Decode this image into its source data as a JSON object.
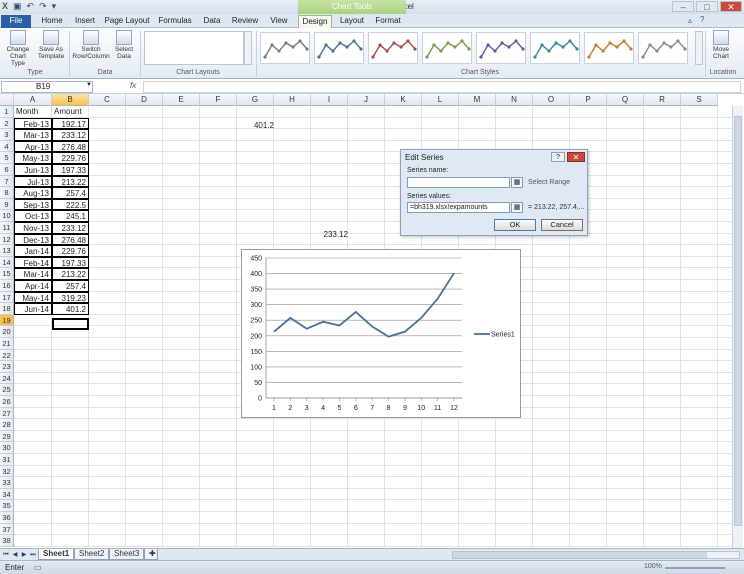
{
  "window": {
    "title": "bh319  -  Microsoft Excel",
    "context_title": "Chart Tools",
    "minimize": "–",
    "restore": "□",
    "close": "✕"
  },
  "qat_icons": [
    "excel-logo-icon",
    "save-icon",
    "undo-icon",
    "redo-icon",
    "customize-icon"
  ],
  "ribbon": {
    "tabs": [
      "File",
      "Home",
      "Insert",
      "Page Layout",
      "Formulas",
      "Data",
      "Review",
      "View",
      "Design",
      "Layout",
      "Format"
    ],
    "active_tab": "Design",
    "buttons": {
      "change_chart_type": "Change Chart Type",
      "save_as_template": "Save As Template",
      "switch_row_column": "Switch Row/Column",
      "select_data": "Select Data",
      "move_chart": "Move Chart"
    },
    "groups": {
      "type": "Type",
      "data": "Data",
      "chart_layouts": "Chart Layouts",
      "chart_styles": "Chart Styles",
      "location": "Location"
    }
  },
  "formula_bar": {
    "name_box": "B19",
    "fx": "fx",
    "value": ""
  },
  "columns": [
    "A",
    "B",
    "C",
    "D",
    "E",
    "F",
    "G",
    "H",
    "I",
    "J",
    "K",
    "L",
    "M",
    "N",
    "O",
    "P",
    "Q",
    "R",
    "S"
  ],
  "selected_column": "B",
  "rows": [
    "1",
    "2",
    "3",
    "4",
    "5",
    "6",
    "7",
    "8",
    "9",
    "10",
    "11",
    "12",
    "13",
    "14",
    "15",
    "16",
    "17",
    "18",
    "19",
    "20",
    "21",
    "22",
    "23",
    "24",
    "25",
    "26",
    "27",
    "28",
    "29",
    "30",
    "31",
    "32",
    "33",
    "34",
    "35",
    "36",
    "37",
    "38"
  ],
  "selected_row": "19",
  "table": {
    "headers": [
      "Month",
      "Amount"
    ],
    "rows": [
      [
        "Feb-13",
        "192.17"
      ],
      [
        "Mar-13",
        "233.12"
      ],
      [
        "Apr-13",
        "276.48"
      ],
      [
        "May-13",
        "229.76"
      ],
      [
        "Jun-13",
        "197.33"
      ],
      [
        "Jul-13",
        "213.22"
      ],
      [
        "Aug-13",
        "257.4"
      ],
      [
        "Sep-13",
        "222.5"
      ],
      [
        "Oct-13",
        "245.1"
      ],
      [
        "Nov-13",
        "233.12"
      ],
      [
        "Dec-13",
        "276.48"
      ],
      [
        "Jan-14",
        "229.76"
      ],
      [
        "Feb-14",
        "197.33"
      ],
      [
        "Mar-14",
        "213.22"
      ],
      [
        "Apr-14",
        "257.4"
      ],
      [
        "May-14",
        "319.23"
      ],
      [
        "Jun-14",
        "401.2"
      ]
    ]
  },
  "loose_cells": {
    "g2": "401.2",
    "i11": "233.12"
  },
  "chart_data": {
    "type": "line",
    "x": [
      1,
      2,
      3,
      4,
      5,
      6,
      7,
      8,
      9,
      10,
      11,
      12
    ],
    "series": [
      {
        "name": "Series1",
        "values": [
          213.22,
          257.4,
          222.5,
          245.1,
          233.12,
          276.48,
          229.76,
          197.33,
          213.22,
          257.4,
          319.23,
          401.2
        ]
      }
    ],
    "yticks": [
      0,
      50,
      100,
      150,
      200,
      250,
      300,
      350,
      400,
      450
    ],
    "ylim": [
      0,
      450
    ],
    "grid": true,
    "legend": "right",
    "color": "#4a6f9b"
  },
  "dialog": {
    "title": "Edit Series",
    "help": "?",
    "close": "✕",
    "series_name_label": "Series name:",
    "series_name_value": "",
    "select_range_hint": "Select Range",
    "series_values_label": "Series values:",
    "series_values_value": "=bh319.xlsx!expamounts",
    "series_values_preview": "= 213.22, 257.4,...",
    "ok": "OK",
    "cancel": "Cancel"
  },
  "sheets": [
    "Sheet1",
    "Sheet2",
    "Sheet3"
  ],
  "active_sheet": "Sheet1",
  "status": {
    "mode": "Enter",
    "zoom": "100%"
  }
}
